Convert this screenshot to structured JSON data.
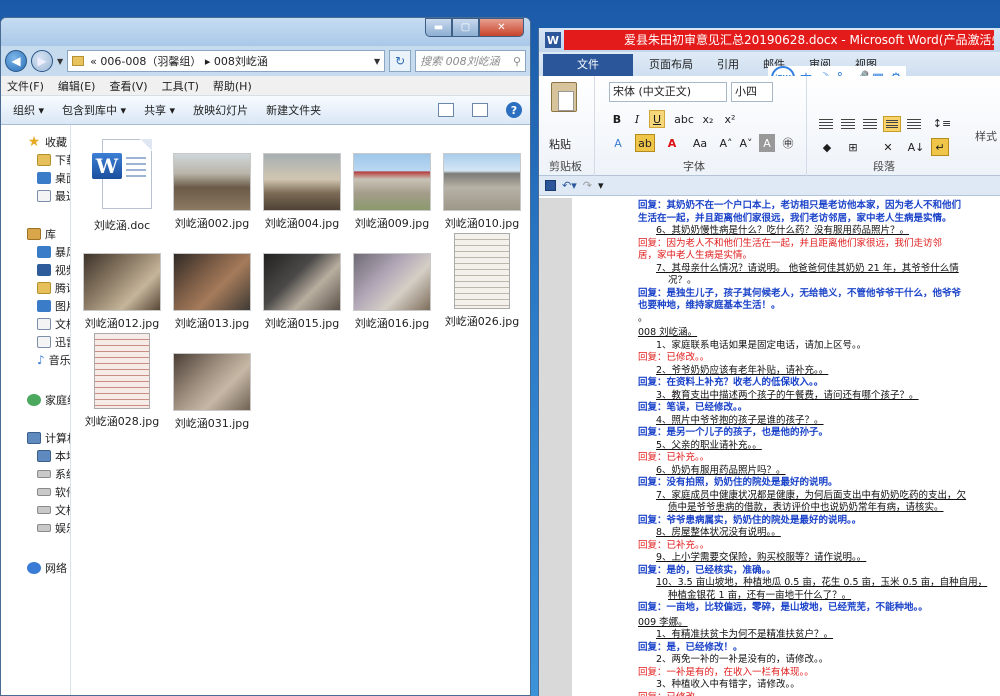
{
  "explorer": {
    "path": "« 006-008（羽馨组） ▸ 008刘屹涵",
    "search_placeholder": "搜索 008刘屹涵",
    "menu": [
      "文件(F)",
      "编辑(E)",
      "查看(V)",
      "工具(T)",
      "帮助(H)"
    ],
    "toolbar": [
      "组织 ▾",
      "包含到库中 ▾",
      "共享 ▾",
      "放映幻灯片",
      "新建文件夹"
    ],
    "nav": {
      "favorites": "收藏",
      "fav_items": [
        "下载",
        "桌面",
        "最近"
      ],
      "libraries": "库",
      "lib_items": [
        "暴风",
        "视频",
        "腾讯",
        "图片",
        "文档",
        "迅雷",
        "音乐"
      ],
      "homegroup": "家庭组",
      "computer": "计算机",
      "comp_items": [
        "本地",
        "系统",
        "软件",
        "文档",
        "娱乐"
      ],
      "network": "网络"
    },
    "files": [
      {
        "name": "刘屹涵.doc",
        "icon": "word-doc-icon"
      },
      {
        "name": "刘屹涵002.jpg"
      },
      {
        "name": "刘屹涵004.jpg"
      },
      {
        "name": "刘屹涵009.jpg"
      },
      {
        "name": "刘屹涵010.jpg"
      },
      {
        "name": "刘屹涵012.jpg"
      },
      {
        "name": "刘屹涵013.jpg"
      },
      {
        "name": "刘屹涵015.jpg"
      },
      {
        "name": "刘屹涵016.jpg"
      },
      {
        "name": "刘屹涵026.jpg"
      },
      {
        "name": "刘屹涵028.jpg"
      },
      {
        "name": "刘屹涵031.jpg"
      }
    ]
  },
  "word": {
    "title": "爱县朱田初审意见汇总20190628.docx - Microsoft Word(产品激活失败)",
    "tabs": [
      "文件",
      "开始",
      "插入",
      "页面布局",
      "引用",
      "邮件",
      "审阅",
      "视图"
    ],
    "font_name": "宋体 (中文正文)",
    "font_size": "小四",
    "paste_label": "粘贴",
    "group_labels": {
      "clipboard": "剪贴板",
      "font": "字体",
      "paragraph": "段落",
      "style": "样式"
    },
    "ifly_label": "iFLY",
    "doc_lines": [
      {
        "t": "回复：其奶奶不在一个户口本上，老访相只是老访他本家，因为老人不和他们",
        "s": "blue"
      },
      {
        "t": "生活在一起，并且距离他们家很远，我们老访邻居，家中老人生病是实情。",
        "s": "blue"
      },
      {
        "t": "6、其奶奶慢性病是什么？吃什么药？没有服用药品照片？。",
        "s": "q ind u"
      },
      {
        "t": "回复：因为老人不和他们生活在一起，并且距离他们家很远，我们走访邻",
        "s": "red"
      },
      {
        "t": "居，家中老人生病是实情。",
        "s": "red"
      },
      {
        "t": "7、其母亲什么情况？请说明。 他爸爸何佳其奶奶 21 年，其爷爷什么情",
        "s": "q ind u"
      },
      {
        "t": "况？。",
        "s": "q ind2"
      },
      {
        "t": "回复：是独生儿子，孩子其何候老人，无给艳义，不管他爷爷干什么，他爷爷",
        "s": "blue"
      },
      {
        "t": "也要种地，维持家庭基本生活！。",
        "s": "blue"
      },
      {
        "t": "。",
        "s": "q"
      },
      {
        "t": "008 刘屹涵。",
        "s": "head u"
      },
      {
        "t": "1、家庭联系电话如果是固定电话，请加上区号。。",
        "s": "q ind"
      },
      {
        "t": "回复：已修改。。",
        "s": "red"
      },
      {
        "t": "2、爷爷奶奶应该有老年补贴，请补充。。",
        "s": "q ind u"
      },
      {
        "t": "回复：在资料上补充？收老人的低保收入。。",
        "s": "blue"
      },
      {
        "t": "3、教育支出中描述两个孩子的午餐费，请问还有哪个孩子？。",
        "s": "q ind u"
      },
      {
        "t": "回复：笔误，已经修改。。",
        "s": "blue"
      },
      {
        "t": "4、照片中爷爷抱的孩子是谁的孩子？。",
        "s": "q ind u"
      },
      {
        "t": "回复：是另一个儿子的孩子，也是他的孙子。",
        "s": "blue"
      },
      {
        "t": "5、父亲的职业请补充。。",
        "s": "q ind u"
      },
      {
        "t": "回复：已补充。。",
        "s": "red"
      },
      {
        "t": "6、奶奶有服用药品照片吗？。",
        "s": "q ind u"
      },
      {
        "t": "回复：没有拍照，奶奶住的院处是最好的说明。",
        "s": "blue"
      },
      {
        "t": "7、家庭成员中健康状况都是健康，为何后面支出中有奶奶吃药的支出，欠",
        "s": "q ind u"
      },
      {
        "t": "债中是爷爷患病的借款，表访评价中也说奶奶常年有病，请核实。",
        "s": "q ind2 u"
      },
      {
        "t": "回复：爷爷患病属实，奶奶住的院处是最好的说明。。",
        "s": "blue"
      },
      {
        "t": "8、房屋整体状况没有说明。。",
        "s": "q ind u"
      },
      {
        "t": "回复：已补充。。",
        "s": "red"
      },
      {
        "t": "9、上小学需要交保险，购买校服等？请作说明。。",
        "s": "q ind u"
      },
      {
        "t": "回复：是的，已经核实，准确。。",
        "s": "blue"
      },
      {
        "t": "10、3.5 亩山坡地，种植地瓜 0.5 亩，花生 0.5 亩，玉米 0.5 亩，自种自用，",
        "s": "q ind u"
      },
      {
        "t": "种植金银花 1 亩，还有一亩地干什么了？。",
        "s": "q ind2 u"
      },
      {
        "t": "回复：一亩地，比较偏远，零碎，是山坡地，已经荒芜，不能种地。。",
        "s": "blue"
      },
      {
        "t": "009 李娜。",
        "s": "head u"
      },
      {
        "t": "1、有精准扶贫卡为何不是精准扶贫户？。",
        "s": "q ind u"
      },
      {
        "t": "回复：是，已经修改！。",
        "s": "blue"
      },
      {
        "t": "2、两免一补的一补是没有的，请修改。。",
        "s": "q ind"
      },
      {
        "t": "回复：一补是有的，在收入一栏有体现。。",
        "s": "red"
      },
      {
        "t": "3、种植收入中有错字，请修改。。",
        "s": "q ind"
      },
      {
        "t": "回复：已修改。。",
        "s": "red"
      }
    ]
  }
}
